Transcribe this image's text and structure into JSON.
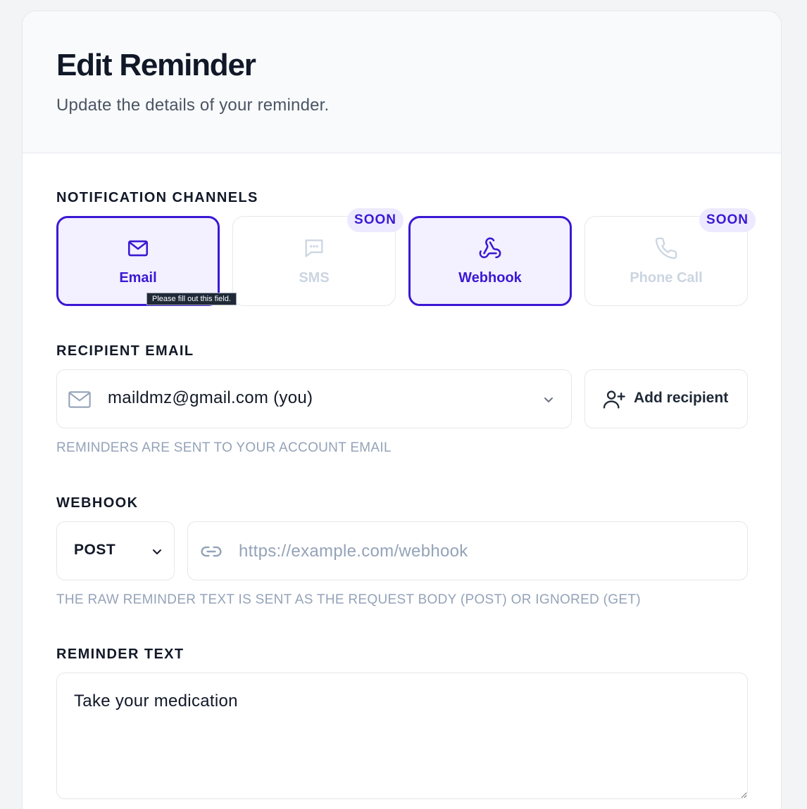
{
  "header": {
    "title": "Edit Reminder",
    "subtitle": "Update the details of your reminder."
  },
  "channels": {
    "label": "NOTIFICATION CHANNELS",
    "items": [
      {
        "label": "Email",
        "icon": "mail-icon",
        "selected": true,
        "badge": ""
      },
      {
        "label": "SMS",
        "icon": "message-icon",
        "selected": false,
        "badge": "SOON"
      },
      {
        "label": "Webhook",
        "icon": "webhook-icon",
        "selected": true,
        "badge": ""
      },
      {
        "label": "Phone Call",
        "icon": "phone-icon",
        "selected": false,
        "badge": "SOON"
      }
    ],
    "tooltip": "Please fill out this field."
  },
  "recipient": {
    "label": "RECIPIENT EMAIL",
    "value": "maildmz@gmail.com (you)",
    "add_label": "Add recipient",
    "hint": "REMINDERS ARE SENT TO YOUR ACCOUNT EMAIL"
  },
  "webhook": {
    "label": "WEBHOOK",
    "method": "POST",
    "url_placeholder": "https://example.com/webhook",
    "url_value": "",
    "hint": "THE RAW REMINDER TEXT IS SENT AS THE REQUEST BODY (POST) OR IGNORED (GET)"
  },
  "reminder": {
    "label": "REMINDER TEXT",
    "value": "Take your medication"
  },
  "colors": {
    "accent": "#3b18d4",
    "accent_bg": "#f3f0ff",
    "badge_bg": "#ede9fe",
    "muted": "#94a3b8"
  }
}
